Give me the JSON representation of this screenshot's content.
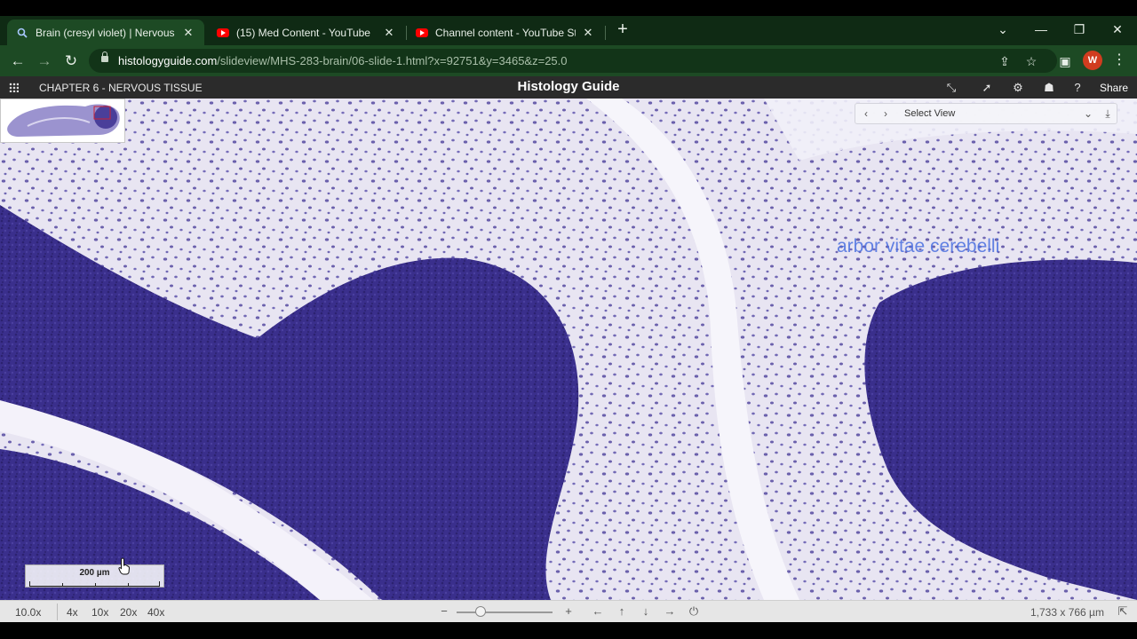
{
  "tabs": [
    {
      "label": "Brain (cresyl violet) | Nervous Tissue",
      "icon": "search-icon",
      "active": true
    },
    {
      "label": "(15) Med Content - YouTube",
      "icon": "youtube-icon",
      "active": false
    },
    {
      "label": "Channel content - YouTube Studio",
      "icon": "youtube-icon",
      "active": false
    }
  ],
  "address": {
    "host": "histologyguide.com",
    "path": "/slideview/MHS-283-brain/06-slide-1.html?x=92751&y=3465&z=25.0"
  },
  "profile": {
    "initial": "W",
    "color": "#d13c1f"
  },
  "header": {
    "chapter": "CHAPTER 6 - NERVOUS TISSUE",
    "title": "Histology Guide",
    "share_label": "Share"
  },
  "viewer": {
    "select_view_label": "Select View",
    "annotation": "arbor vitae cerebelli",
    "scale_label": "200 µm"
  },
  "status": {
    "zoom": "10.0x",
    "magnifications": [
      "4x",
      "10x",
      "20x",
      "40x"
    ],
    "zoom_level": 0.25,
    "dimensions": "1,733 x 766 µm"
  },
  "colors": {
    "tab_strip": "#0f2a14",
    "toolbar": "#1d4a24",
    "stain_dark": "#3a2f8c",
    "stain_light": "#e9e6f3",
    "annotation": "#4a6fe0"
  }
}
